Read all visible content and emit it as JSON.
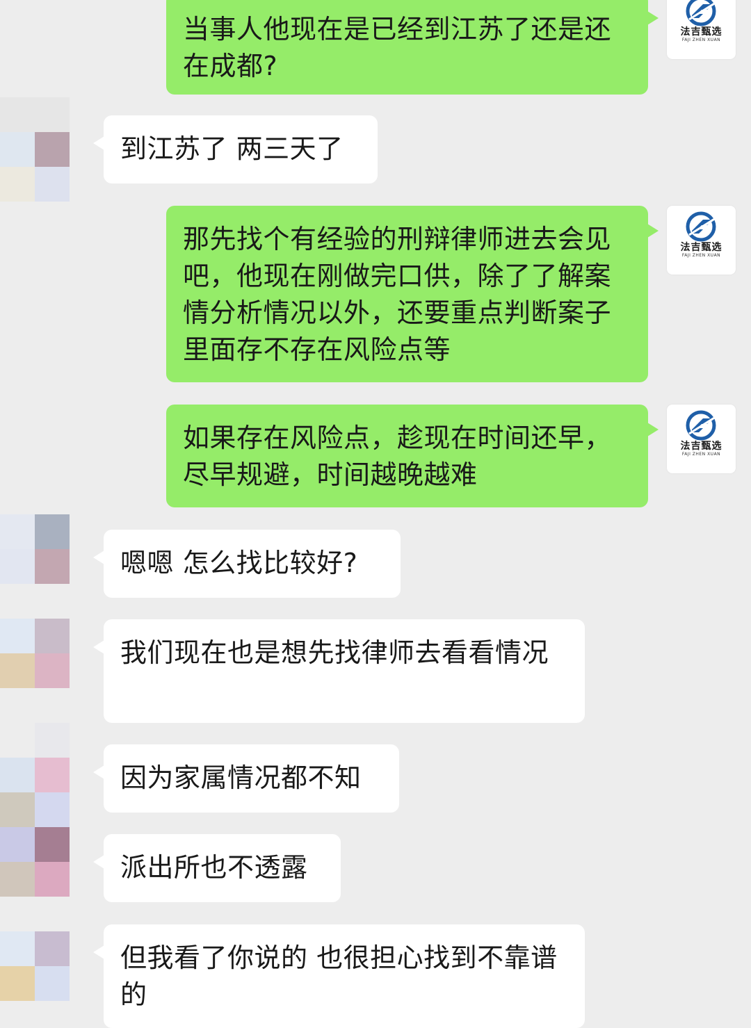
{
  "conversation": {
    "messages": [
      {
        "direction": "outgoing",
        "text": "当事人他现在是已经到江苏了还是还在成都?"
      },
      {
        "direction": "incoming",
        "text": "到江苏了 两三天了"
      },
      {
        "direction": "outgoing",
        "text": "那先找个有经验的刑辩律师进去会见吧，他现在刚做完口供，除了了解案情分析情况以外，还要重点判断案子里面存不存在风险点等"
      },
      {
        "direction": "outgoing",
        "text": "如果存在风险点，趁现在时间还早，尽早规避，时间越晚越难"
      },
      {
        "direction": "incoming",
        "text": "嗯嗯 怎么找比较好?"
      },
      {
        "direction": "incoming",
        "text": "我们现在也是想先找律师去看看情况"
      },
      {
        "direction": "incoming",
        "text": "因为家属情况都不知"
      },
      {
        "direction": "incoming",
        "text": "派出所也不透露"
      },
      {
        "direction": "incoming",
        "text": "但我看了你说的 也很担心找到不靠谱的"
      }
    ]
  },
  "sender_logo": {
    "name": "法吉甄选",
    "subtitle": "FAJI ZHEN XUAN",
    "icon": "fj-logo-icon",
    "color": "#1f5fa8"
  },
  "colors": {
    "outgoing_bubble": "#95ec69",
    "incoming_bubble": "#ffffff",
    "background": "#ededed"
  }
}
